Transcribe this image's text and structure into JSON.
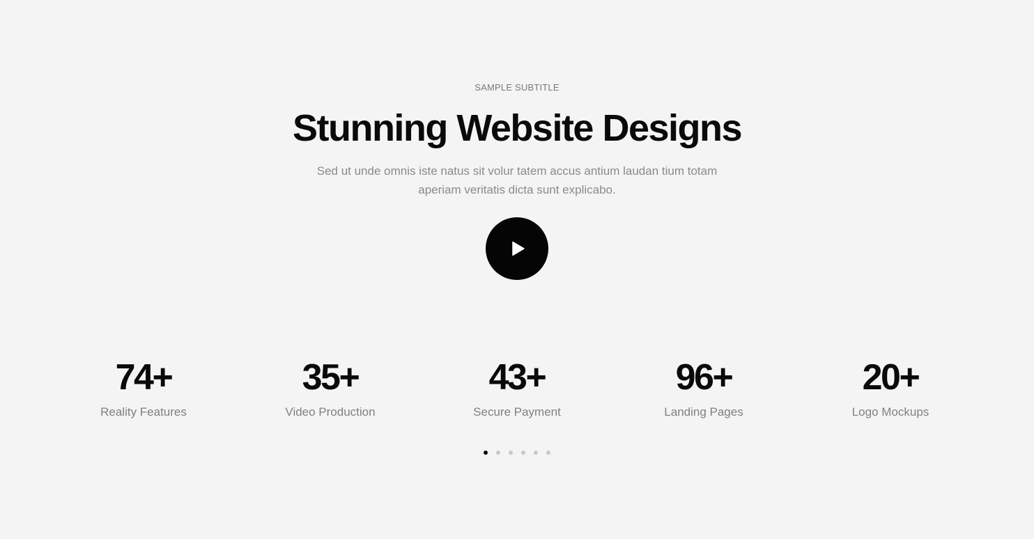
{
  "hero": {
    "subtitle": "SAMPLE SUBTITLE",
    "title": "Stunning Website Designs",
    "description": "Sed ut unde omnis iste natus sit volur tatem accus antium laudan tium totam aperiam veritatis dicta sunt explicabo.",
    "play_icon": "play-icon"
  },
  "stats": [
    {
      "value": "74+",
      "label": "Reality Features"
    },
    {
      "value": "35+",
      "label": "Video Production"
    },
    {
      "value": "43+",
      "label": "Secure Payment"
    },
    {
      "value": "96+",
      "label": "Landing Pages"
    },
    {
      "value": "20+",
      "label": "Logo Mockups"
    }
  ],
  "pagination": {
    "count": 6,
    "active": 1
  },
  "colors": {
    "background": "#f4f4f4",
    "text_primary": "#0a0a0a",
    "text_muted": "#7f7f7f",
    "dot_inactive": "#c8c8c8",
    "dot_active": "#0a0a0a"
  }
}
